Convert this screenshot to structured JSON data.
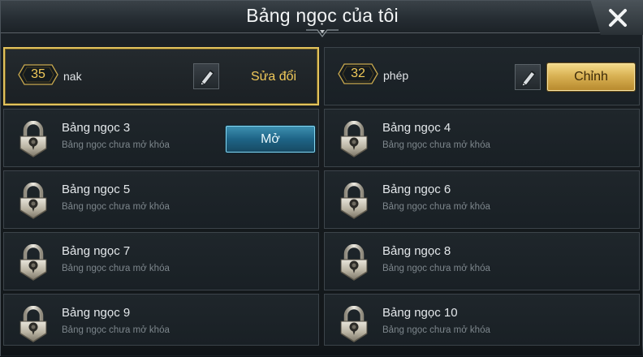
{
  "window": {
    "title": "Bảng ngọc của tôi"
  },
  "header": {
    "close_icon": "close-x-icon"
  },
  "pages": [
    {
      "level": "35",
      "name": "nak",
      "action_label": "Sửa đổi",
      "selected": true
    },
    {
      "level": "32",
      "name": "phép",
      "action_label": "Chỉnh",
      "selected": false
    }
  ],
  "locked_slots": [
    {
      "title": "Bảng ngọc 3",
      "subtitle": "Bảng ngọc chưa mở khóa",
      "button_label": "Mở"
    },
    {
      "title": "Bảng ngọc 4",
      "subtitle": "Bảng ngọc chưa mở khóa"
    },
    {
      "title": "Bảng ngọc 5",
      "subtitle": "Bảng ngọc chưa mở khóa"
    },
    {
      "title": "Bảng ngọc 6",
      "subtitle": "Bảng ngọc chưa mở khóa"
    },
    {
      "title": "Bảng ngọc 7",
      "subtitle": "Bảng ngọc chưa mở khóa"
    },
    {
      "title": "Bảng ngọc 8",
      "subtitle": "Bảng ngọc chưa mở khóa"
    },
    {
      "title": "Bảng ngọc 9",
      "subtitle": "Bảng ngọc chưa mở khóa"
    },
    {
      "title": "Bảng ngọc 10",
      "subtitle": "Bảng ngọc chưa mở khóa"
    }
  ],
  "colors": {
    "gold": "#f0c95a",
    "selected_border": "#e2c25c",
    "blue_button": "#1e6486",
    "panel": "#192025"
  }
}
